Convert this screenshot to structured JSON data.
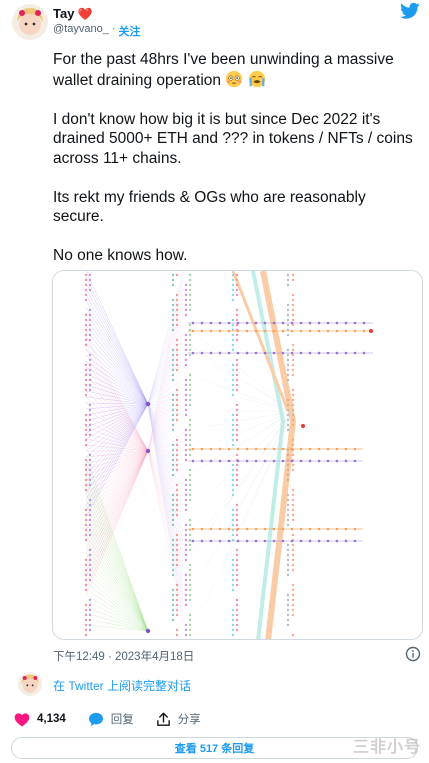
{
  "author": {
    "name": "Tay",
    "name_emoji": "❤️",
    "handle": "@tayvano_",
    "separator": "·",
    "follow_label": "关注"
  },
  "icons": {
    "platform": "twitter-bird-icon",
    "info": "info-icon",
    "like": "heart-icon",
    "reply": "reply-bubble-icon",
    "share": "share-icon",
    "emoji_1": "flushed-face-icon",
    "emoji_2": "crying-face-icon"
  },
  "tweet": {
    "line_1": "For the past 48hrs I've been unwinding a massive wallet draining operation",
    "line_2": "I don't know how big it is but since Dec 2022 it's drained 5000+ ETH and ??? in tokens / NFTs / coins across 11+ chains.",
    "line_3": "Its rekt my friends & OGs who are reasonably secure.",
    "line_4": "No one knows how."
  },
  "timestamp": "下午12:49 · 2023年4月18日",
  "thread_link": "在 Twitter 上阅读完整对话",
  "actions": {
    "likes": "4,134",
    "reply_label": "回复",
    "share_label": "分享"
  },
  "replies_button": "查看 517 条回复",
  "watermark": "三非小号",
  "colors": {
    "accent": "#1d9bf0",
    "like": "#f91880",
    "text": "#0f1419",
    "muted": "#536471",
    "border": "#cfd9de"
  }
}
